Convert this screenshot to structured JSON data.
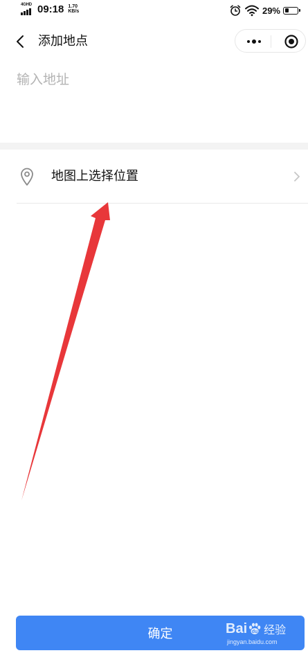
{
  "status_bar": {
    "network_type": "4GHD",
    "time": "09:18",
    "speed_value": "1.70",
    "speed_unit": "KB/s",
    "battery_percent": "29%",
    "battery_level": 0.29,
    "icons": [
      "signal-icon",
      "alarm-icon",
      "wifi-icon",
      "battery-icon"
    ]
  },
  "nav": {
    "title": "添加地点",
    "icons": [
      "back-icon",
      "more-icon",
      "target-icon"
    ]
  },
  "address": {
    "placeholder": "输入地址",
    "value": ""
  },
  "map_select": {
    "label": "地图上选择位置",
    "icons": [
      "location-pin-icon",
      "chevron-right-icon"
    ]
  },
  "confirm": {
    "label": "确定"
  },
  "watermark": {
    "brand": "Bai",
    "brand_suffix": "经验",
    "url": "jingyan.baidu.com",
    "icon": "baidu-paw-icon"
  },
  "colors": {
    "primary": "#3f86f4",
    "annotation_arrow": "#e8373a",
    "placeholder": "#b3b3b3",
    "divider": "#e9e9e9",
    "section_gap": "#f3f3f3"
  }
}
